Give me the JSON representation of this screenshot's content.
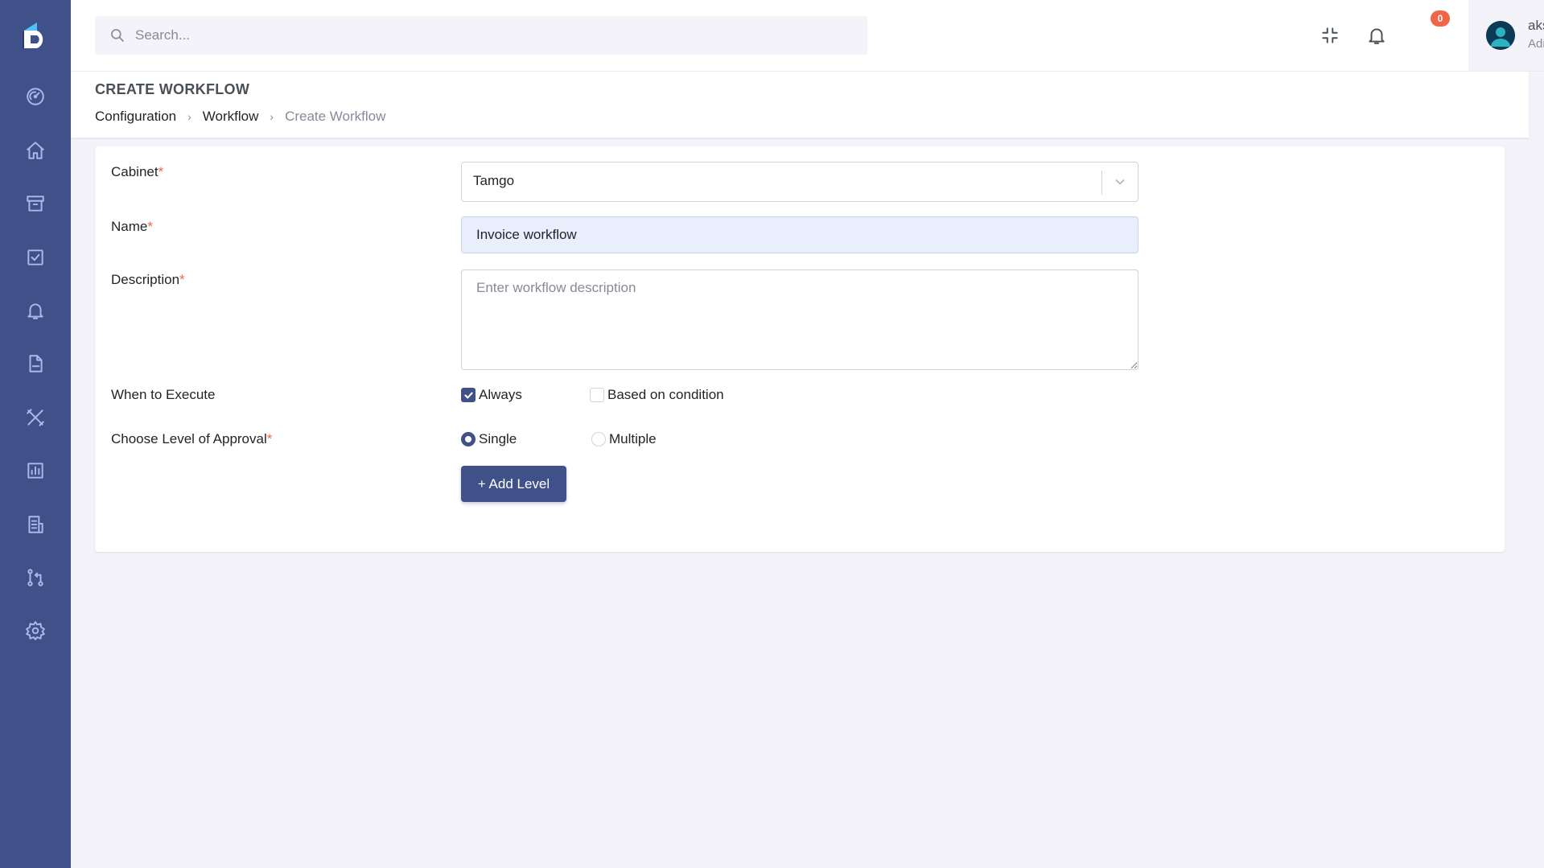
{
  "search": {
    "placeholder": "Search..."
  },
  "notifications": {
    "count": "0"
  },
  "user": {
    "name": "akshith",
    "role": "Admin"
  },
  "page": {
    "title": "CREATE WORKFLOW",
    "breadcrumb": [
      "Configuration",
      "Workflow",
      "Create Workflow"
    ]
  },
  "form": {
    "cabinet": {
      "label": "Cabinet",
      "required": "*",
      "value": "Tamgo"
    },
    "name": {
      "label": "Name",
      "required": "*",
      "value": "Invoice workflow"
    },
    "description": {
      "label": "Description",
      "required": "*",
      "placeholder": "Enter workflow description",
      "value": ""
    },
    "when_to_execute": {
      "label": "When to Execute",
      "options": [
        {
          "label": "Always",
          "checked": true
        },
        {
          "label": "Based on condition",
          "checked": false
        }
      ]
    },
    "approval_level": {
      "label": "Choose Level of Approval",
      "required": "*",
      "options": [
        {
          "label": "Single",
          "selected": true
        },
        {
          "label": "Multiple",
          "selected": false
        }
      ]
    },
    "add_level_button": "+ Add Level"
  },
  "sidebar": {
    "items": [
      {
        "icon": "dashboard-gauge-icon"
      },
      {
        "icon": "home-icon"
      },
      {
        "icon": "archive-icon"
      },
      {
        "icon": "task-checkbox-icon"
      },
      {
        "icon": "bell-icon"
      },
      {
        "icon": "pdf-file-icon"
      },
      {
        "icon": "tools-icon"
      },
      {
        "icon": "bar-chart-icon"
      },
      {
        "icon": "report-icon"
      },
      {
        "icon": "workflow-icon"
      },
      {
        "icon": "settings-gear-icon"
      }
    ]
  },
  "colors": {
    "primary": "#405189",
    "sidebar": "#405189",
    "danger": "#f06548",
    "background": "#f3f3f9"
  }
}
